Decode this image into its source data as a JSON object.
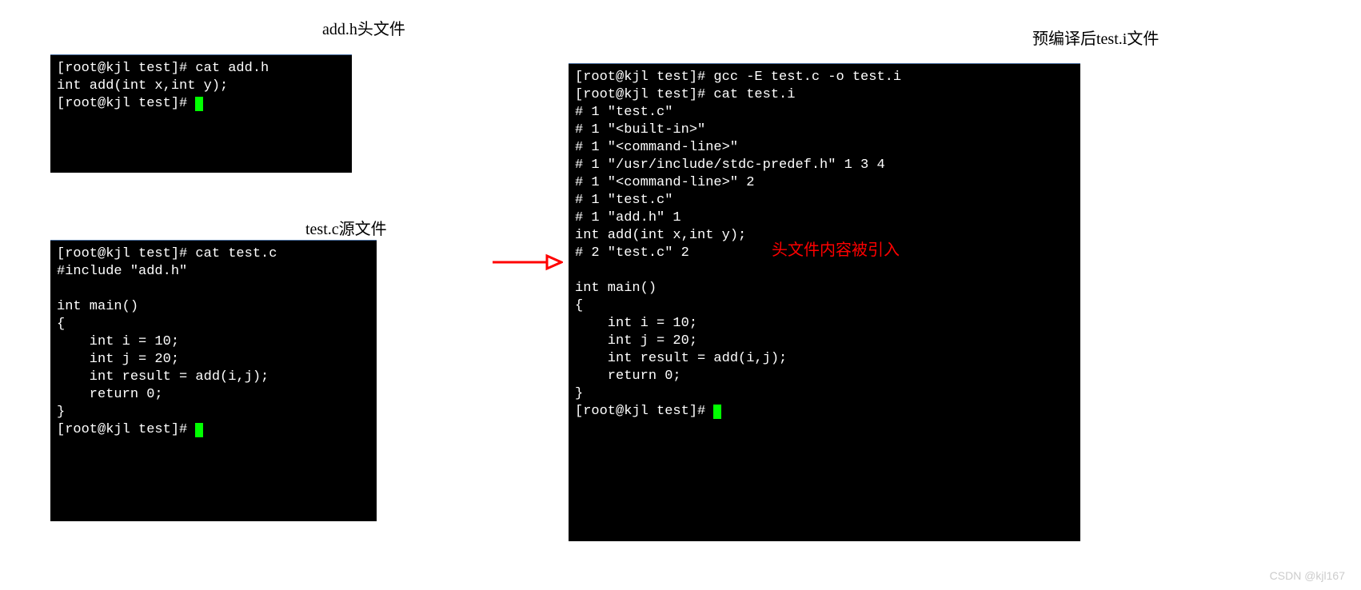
{
  "captions": {
    "addh": "add.h头文件",
    "testc": "test.c源文件",
    "testi": "预编译后test.i文件"
  },
  "terminals": {
    "addh": {
      "content": "[root@kjl test]# cat add.h\nint add(int x,int y);\n[root@kjl test]# "
    },
    "testc": {
      "content": "[root@kjl test]# cat test.c\n#include \"add.h\"\n\nint main()\n{\n    int i = 10;\n    int j = 20;\n    int result = add(i,j);\n    return 0;\n}\n[root@kjl test]# "
    },
    "testi": {
      "content": "[root@kjl test]# gcc -E test.c -o test.i\n[root@kjl test]# cat test.i\n# 1 \"test.c\"\n# 1 \"<built-in>\"\n# 1 \"<command-line>\"\n# 1 \"/usr/include/stdc-predef.h\" 1 3 4\n# 1 \"<command-line>\" 2\n# 1 \"test.c\"\n# 1 \"add.h\" 1\nint add(int x,int y);\n# 2 \"test.c\" 2\n\nint main()\n{\n    int i = 10;\n    int j = 20;\n    int result = add(i,j);\n    return 0;\n}\n[root@kjl test]# "
    }
  },
  "annotation": "头文件内容被引入",
  "watermark": "CSDN @kjl167"
}
